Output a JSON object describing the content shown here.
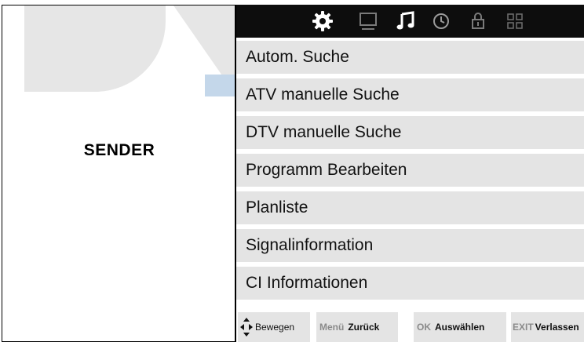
{
  "section": {
    "title": "SENDER"
  },
  "tabs": [
    {
      "name": "settings-gear-icon",
      "active": true
    },
    {
      "name": "picture-monitor-icon",
      "active": false
    },
    {
      "name": "sound-music-icon",
      "active": false
    },
    {
      "name": "time-clock-icon",
      "active": false
    },
    {
      "name": "lock-icon",
      "active": false
    },
    {
      "name": "setup-grid-icon",
      "active": false
    }
  ],
  "menu": {
    "items": [
      {
        "label": "Autom. Suche"
      },
      {
        "label": "ATV manuelle Suche"
      },
      {
        "label": "DTV manuelle Suche"
      },
      {
        "label": "Programm Bearbeiten"
      },
      {
        "label": "Planliste"
      },
      {
        "label": "Signalinformation"
      },
      {
        "label": "CI Informationen"
      }
    ]
  },
  "footer": {
    "move_label": "Bewegen",
    "back_key": "Menü",
    "back_label": "Zurück",
    "select_key": "OK",
    "select_label": "Auswählen",
    "exit_key": "EXIT",
    "exit_label": "Verlassen"
  },
  "colors": {
    "tab_bar_bg": "#0d0d0d",
    "active_icon": "#ffffff",
    "inactive_icon": "#7a7a7a",
    "menu_item_bg": "#e4e4e4",
    "watermark_gray": "#e6e6e6",
    "watermark_blue": "#c4d7ea"
  }
}
